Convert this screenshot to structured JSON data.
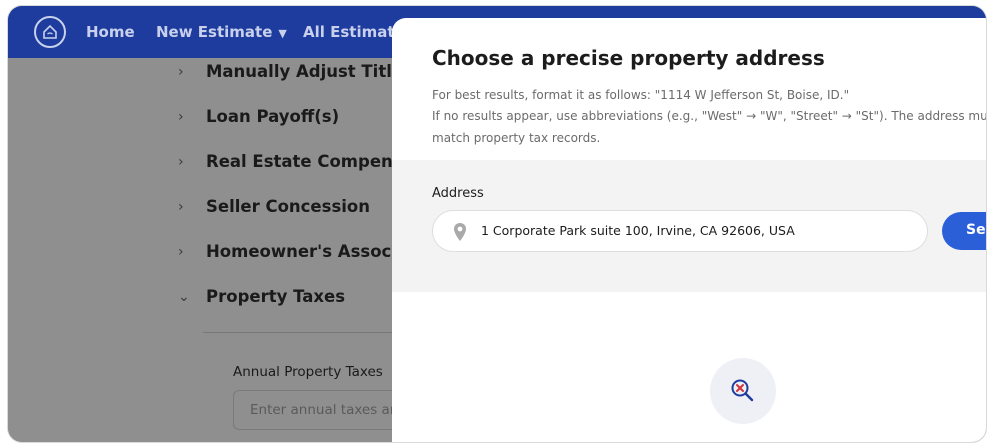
{
  "navbar": {
    "logo_icon": "home-logo-icon",
    "items": [
      {
        "label": "Home"
      },
      {
        "label": "New Estimate",
        "has_dropdown": true
      },
      {
        "label": "All Estimates"
      }
    ]
  },
  "background_page": {
    "accordion": [
      {
        "label": "Manually Adjust Title Fe",
        "expanded": false
      },
      {
        "label": "Loan Payoff(s)",
        "expanded": false
      },
      {
        "label": "Real Estate Compensati",
        "expanded": false
      },
      {
        "label": "Seller Concession",
        "expanded": false
      },
      {
        "label": "Homeowner's Associati",
        "expanded": false
      },
      {
        "label": "Property Taxes",
        "expanded": true
      }
    ],
    "annual_taxes": {
      "label": "Annual Property Taxes",
      "placeholder": "Enter annual taxes ar"
    }
  },
  "modal": {
    "title": "Choose a precise property address",
    "hints": [
      "For best results, format it as follows: \"1114 W Jefferson St, Boise, ID.\"",
      "If no results appear, use abbreviations (e.g., \"West\" → \"W\", \"Street\" → \"St\"). The address mu",
      "match property tax records."
    ],
    "address_label": "Address",
    "address_value": "1 Corporate Park suite 100, Irvine, CA 92606, USA",
    "search_button": "Sea",
    "empty_state_icon": "search-no-results-icon"
  },
  "colors": {
    "navbar": "#1e3c9e",
    "overlay": "#8f8f8f",
    "primary_button": "#2b5fd8",
    "no_result_accent": "#d0343b"
  }
}
